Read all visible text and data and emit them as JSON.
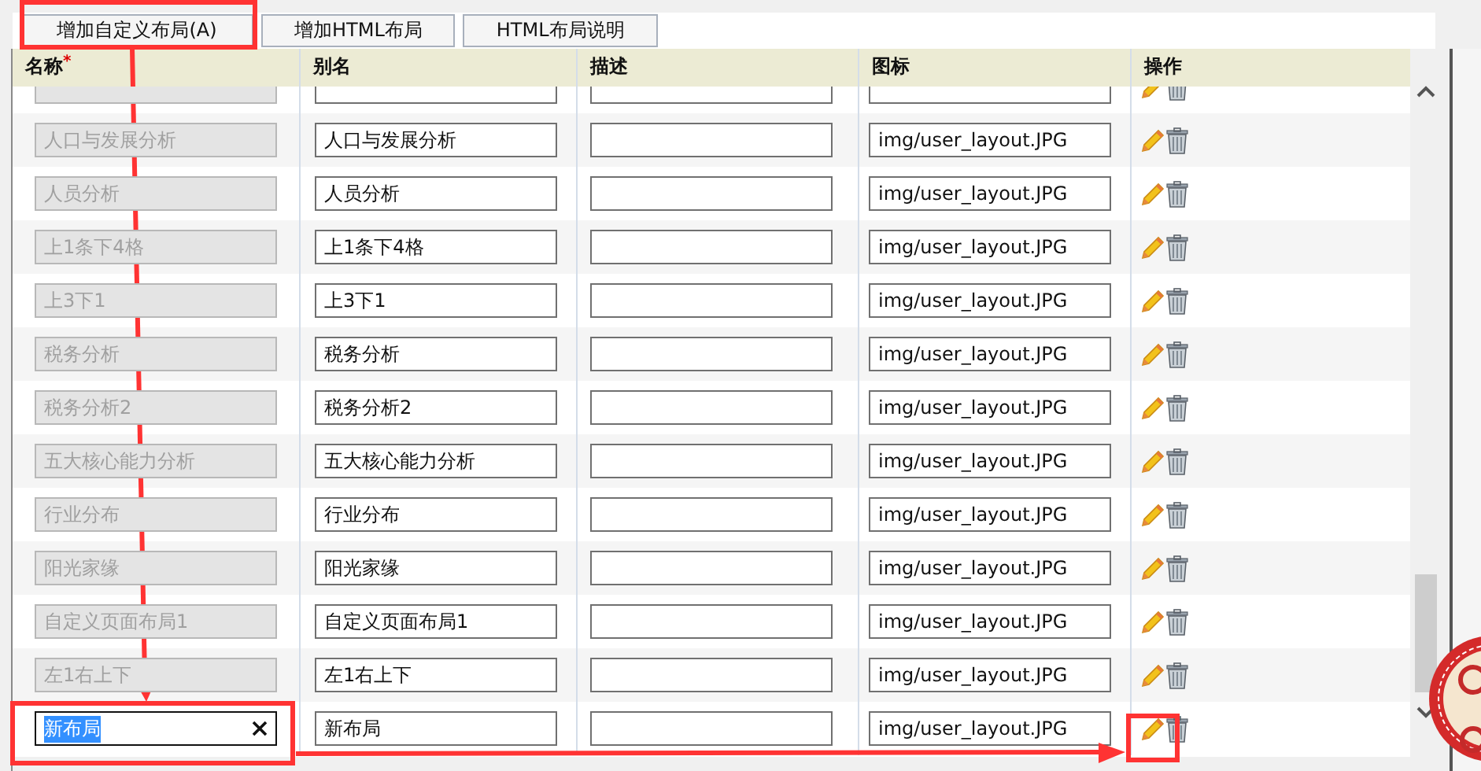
{
  "toolbar": {
    "buttons": [
      {
        "label": "增加自定义布局(A)"
      },
      {
        "label": "增加HTML布局"
      },
      {
        "label": "HTML布局说明"
      }
    ]
  },
  "table": {
    "columns": [
      {
        "label": "名称",
        "required_mark": "*"
      },
      {
        "label": "别名"
      },
      {
        "label": "描述"
      },
      {
        "label": "图标"
      },
      {
        "label": "操作"
      }
    ],
    "rows": [
      {
        "editing": false
      },
      {
        "name": "人口与发展分析",
        "alias": "人口与发展分析",
        "icon": "img/user_layout.JPG",
        "editing": false
      },
      {
        "name": "人员分析",
        "alias": "人员分析",
        "icon": "img/user_layout.JPG",
        "editing": false
      },
      {
        "name": "上1条下4格",
        "alias": "上1条下4格",
        "icon": "img/user_layout.JPG",
        "editing": false
      },
      {
        "name": "上3下1",
        "alias": "上3下1",
        "icon": "img/user_layout.JPG",
        "editing": false
      },
      {
        "name": "税务分析",
        "alias": "税务分析",
        "icon": "img/user_layout.JPG",
        "editing": false
      },
      {
        "name": "税务分析2",
        "alias": "税务分析2",
        "icon": "img/user_layout.JPG",
        "editing": false
      },
      {
        "name": "五大核心能力分析",
        "alias": "五大核心能力分析",
        "icon": "img/user_layout.JPG",
        "editing": false
      },
      {
        "name": "行业分布",
        "alias": "行业分布",
        "icon": "img/user_layout.JPG",
        "editing": false
      },
      {
        "name": "阳光家缘",
        "alias": "阳光家缘",
        "icon": "img/user_layout.JPG",
        "editing": false
      },
      {
        "name": "自定义页面布局1",
        "alias": "自定义页面布局1",
        "icon": "img/user_layout.JPG",
        "editing": false
      },
      {
        "name": "左1右上下",
        "alias": "左1右上下",
        "icon": "img/user_layout.JPG",
        "editing": false
      },
      {
        "name": "新布局",
        "alias": "新布局",
        "icon": "img/user_layout.JPG",
        "editing": true
      }
    ]
  }
}
